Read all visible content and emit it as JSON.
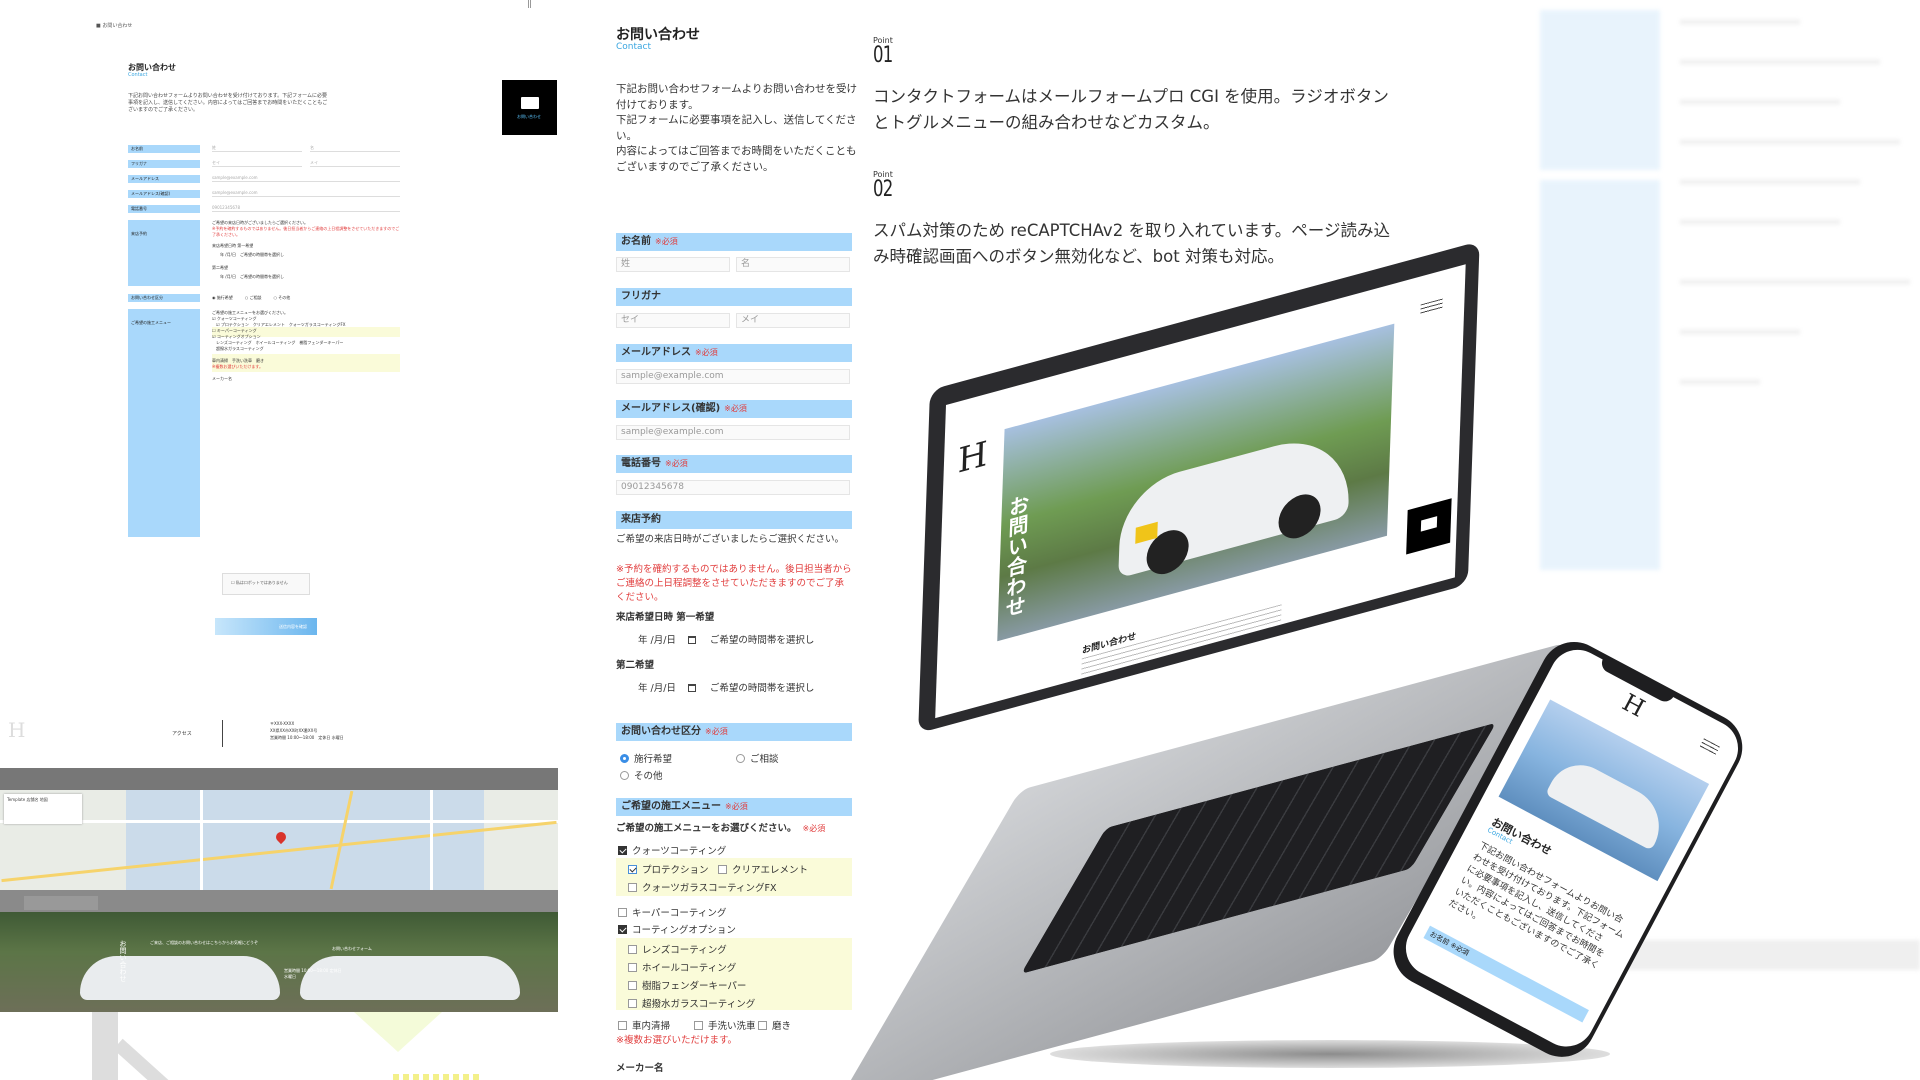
{
  "thumbnail": {
    "breadcrumb": "お問い合わせ",
    "title": "お問い合わせ",
    "subtitle": "Contact",
    "intro": "下記お問い合わせフォームよりお問い合わせを受け付けております。下記フォームに必要事項を記入し、送信してください。内容によってはご回答までお時間をいただくこともございますのでご了承ください。",
    "badge_label": "お問い合わせ",
    "rows": [
      "お名前",
      "フリガナ",
      "メールアドレス",
      "メールアドレス(確認)",
      "電話番号",
      "来店予約",
      "お問い合わせ区分",
      "ご希望の施工メニュー"
    ],
    "placeholders": [
      "姓",
      "名",
      "セイ",
      "メイ",
      "sample@example.com",
      "sample@example.com",
      "09012345678"
    ],
    "recaptcha": "私はロボットではありません",
    "submit": "送信内容を確認",
    "access": "アクセス",
    "address_lines": [
      "〒XXX-XXXX",
      "XX県XX市XX町XX番XX号",
      "営業時間 10:00〜18:00　定休日 水曜日"
    ],
    "map_card": "Template 店舗名 地図",
    "hero_vertical": "お問い合わせ",
    "hero_text": "ご来店、ご相談のお問い合わせはこちらからお気軽にどうぞ",
    "hero_hours": "営業時間 10:00〜18:00 定休日 水曜日",
    "hero_form": "お問い合わせフォーム"
  },
  "form": {
    "title": "お問い合わせ",
    "subtitle": "Contact",
    "intro": "下記お問い合わせフォームよりお問い合わせを受け付けております。\n下記フォームに必要事項を記入し、送信してください。\n内容によってはご回答までお時間をいただくこともございますのでご了承ください。",
    "required": "※必須",
    "name_label": "お名前",
    "name_last": "姓",
    "name_first": "名",
    "kana_label": "フリガナ",
    "kana_last": "セイ",
    "kana_first": "メイ",
    "email_label": "メールアドレス",
    "email_placeholder": "sample@example.com",
    "email2_label": "メールアドレス(確認)",
    "email2_placeholder": "sample@example.com",
    "tel_label": "電話番号",
    "tel_placeholder": "09012345678",
    "visit_label": "来店予約",
    "visit_prompt": "ご希望の来店日時がございましたらご選択ください。",
    "visit_note": "※予約を確約するものではありません。後日担当者からご連絡の上日程調整をさせていただきますのでご了承ください。",
    "first_choice": "来店希望日時 第一希望",
    "second_choice": "第二希望",
    "date_placeholder": "年 /月/日",
    "time_placeholder": "ご希望の時間帯を選択し",
    "category_label": "お問い合わせ区分",
    "category_options": [
      "施行希望",
      "ご相談",
      "その他"
    ],
    "menu_label": "ご希望の施工メニュー",
    "menu_prompt": "ご希望の施工メニューをお選びください。",
    "menu_items": [
      "クォーツコーティング",
      "プロテクション",
      "クリアエレメント",
      "クォーツガラスコーティングFX",
      "キーパーコーティング",
      "コーティングオプション",
      "レンズコーティング",
      "ホイールコーティング",
      "樹脂フェンダーキーパー",
      "超撥水ガラスコーティング",
      "車内清掃",
      "手洗い洗車",
      "磨き"
    ],
    "menu_note": "※複数お選びいただけます。",
    "maker_label": "メーカー名"
  },
  "points": [
    {
      "label": "Point",
      "number": "01",
      "text": "コンタクトフォームはメールフォームプロ CGI を使用。ラジオボタンとトグルメニューの組み合わせなどカスタム。"
    },
    {
      "label": "Point",
      "number": "02",
      "text": "スパム対策のため reCAPTCHAv2 を取り入れています。ページ読み込み時確認画面へのボタン無効化など、bot 対策も対応。"
    }
  ],
  "laptop": {
    "vertical_title": "お問い合わせ",
    "content_title": "お問い合わせ"
  },
  "phone": {
    "title": "お問い合わせ",
    "subtitle": "Contact",
    "intro": "下記お問い合わせフォームよりお問い合わせを受け付けております。下記フォームに必要事項を記入し、送信してください。内容によってはご回答までお時間をいただくこともございますのでご了承ください。",
    "label": "お名前 ※必須"
  },
  "colors": {
    "accent_blue": "#a9d8fb",
    "link_blue": "#3aa6e0",
    "required_red": "#e13c3c",
    "highlight_yellow": "#fafbd9"
  }
}
